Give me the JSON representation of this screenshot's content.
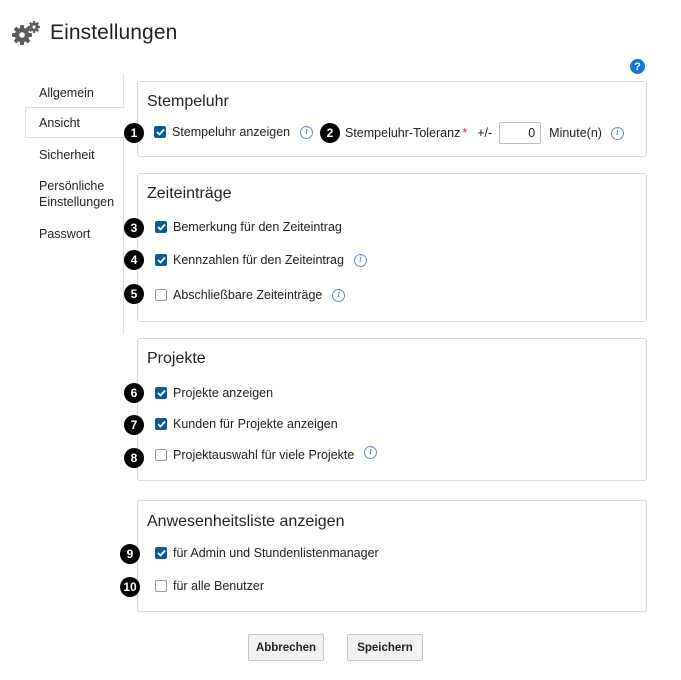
{
  "header": {
    "title": "Einstellungen",
    "icon": "gears-icon"
  },
  "help": {
    "label": "?"
  },
  "sidebar": {
    "items": [
      {
        "label": "Allgemein"
      },
      {
        "label": "Ansicht",
        "active": true
      },
      {
        "label": "Sicherheit"
      },
      {
        "label": "Persönliche Einstellungen"
      },
      {
        "label": "Passwort"
      }
    ]
  },
  "stempeluhr": {
    "title": "Stempeluhr",
    "show_label": "Stempeluhr anzeigen",
    "show_checked": true,
    "tolerance_label": "Stempeluhr-Toleranz",
    "required_mark": "*",
    "plusminus": "+/-",
    "tolerance_value": "0",
    "unit": "Minute(n)"
  },
  "zeiteintraege": {
    "title": "Zeiteinträge",
    "items": [
      {
        "label": "Bemerkung für den Zeiteintrag",
        "checked": true
      },
      {
        "label": "Kennzahlen für den Zeiteintrag",
        "checked": true
      },
      {
        "label": "Abschließbare Zeiteinträge",
        "checked": false
      }
    ]
  },
  "projekte": {
    "title": "Projekte",
    "items": [
      {
        "label": "Projekte anzeigen",
        "checked": true
      },
      {
        "label": "Kunden für Projekte anzeigen",
        "checked": true
      },
      {
        "label": "Projektauswahl für viele Projekte",
        "checked": false
      }
    ]
  },
  "anwesenheit": {
    "title": "Anwesenheitsliste anzeigen",
    "items": [
      {
        "label": "für Admin und Stundenlistenmanager",
        "checked": true
      },
      {
        "label": "für alle Benutzer",
        "checked": false
      }
    ]
  },
  "badges": [
    "1",
    "2",
    "3",
    "4",
    "5",
    "6",
    "7",
    "8",
    "9",
    "10"
  ],
  "buttons": {
    "cancel": "Abbrechen",
    "save": "Speichern"
  },
  "colors": {
    "checkbox_checked": "#0d5b93",
    "help_blue": "#1577d3",
    "info_blue": "#4a7cc3",
    "required": "#dd2222"
  }
}
